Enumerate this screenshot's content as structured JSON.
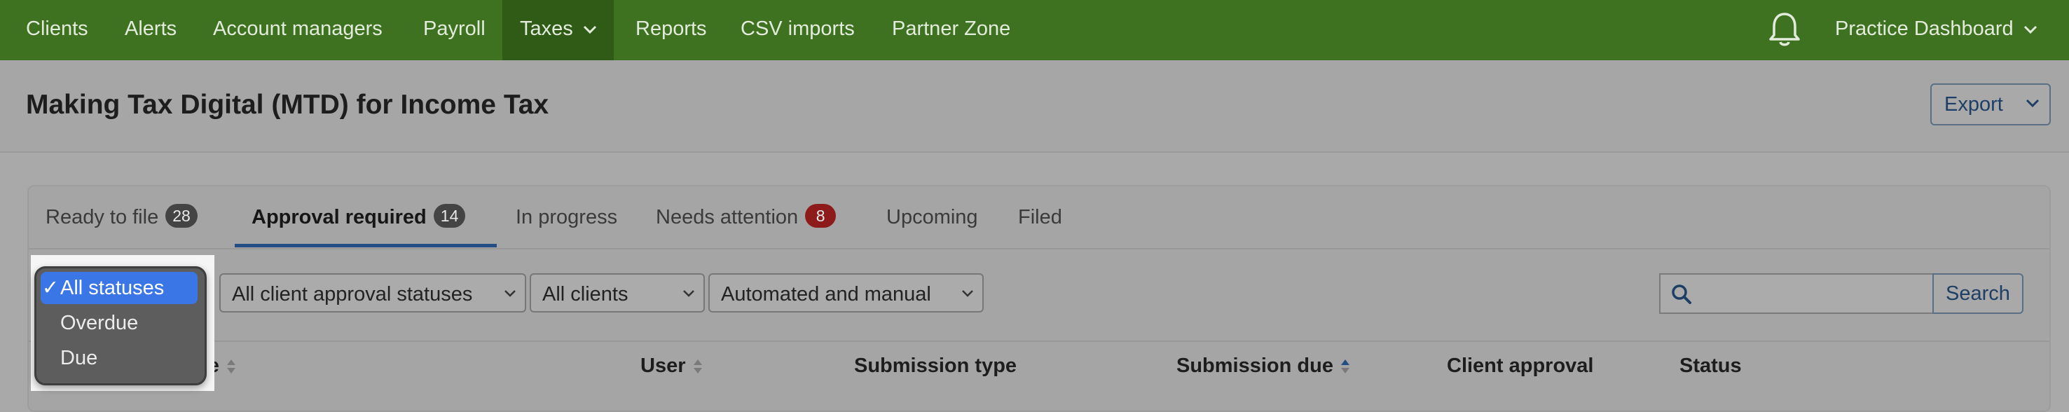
{
  "nav": {
    "items": [
      "Clients",
      "Alerts",
      "Account managers",
      "Payroll",
      "Taxes",
      "Reports",
      "CSV imports",
      "Partner Zone"
    ],
    "practice": "Practice Dashboard"
  },
  "page": {
    "title": "Making Tax Digital (MTD) for Income Tax",
    "export_label": "Export"
  },
  "tabs": [
    {
      "label": "Ready to file",
      "count": "28"
    },
    {
      "label": "Approval required",
      "count": "14"
    },
    {
      "label": "In progress"
    },
    {
      "label": "Needs attention",
      "count": "8"
    },
    {
      "label": "Upcoming"
    },
    {
      "label": "Filed"
    }
  ],
  "filters": {
    "client_approval": "All client approval statuses",
    "clients": "All clients",
    "mode": "Automated and manual"
  },
  "search": {
    "placeholder": "",
    "button": "Search"
  },
  "table": {
    "columns": [
      "me",
      "User",
      "Submission type",
      "Submission due",
      "Client approval",
      "Status"
    ]
  },
  "status_dropdown": {
    "options": [
      "All statuses",
      "Overdue",
      "Due"
    ],
    "selected_check": "✓"
  },
  "colors": {
    "nav_bg": "#3e7221",
    "accent": "#234e85",
    "badge_red": "#8e1b1b",
    "selected_option": "#3b76e6"
  }
}
